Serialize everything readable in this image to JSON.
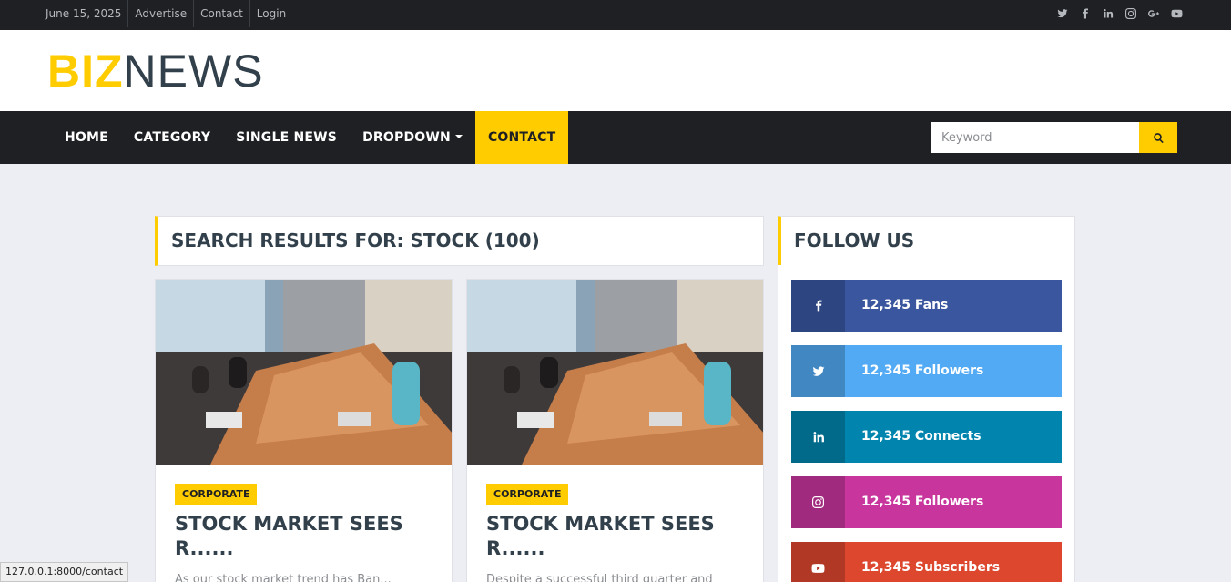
{
  "topbar": {
    "links": [
      "June 15, 2025",
      "Advertise",
      "Contact",
      "Login"
    ],
    "social_icons": [
      "twitter-icon",
      "facebook-icon",
      "linkedin-icon",
      "instagram-icon",
      "google-plus-icon",
      "youtube-icon"
    ]
  },
  "logo": {
    "part1": "BIZ",
    "part2": "NEWS"
  },
  "nav": {
    "items": [
      "HOME",
      "CATEGORY",
      "SINGLE NEWS",
      "DROPDOWN",
      "CONTACT"
    ],
    "active": "CONTACT",
    "search_placeholder": "Keyword"
  },
  "results": {
    "heading": "SEARCH RESULTS FOR: STOCK (100)",
    "cards": [
      {
        "category": "CORPORATE",
        "title": "STOCK MARKET SEES R......",
        "excerpt": "As our stock market trend has Ban..."
      },
      {
        "category": "CORPORATE",
        "title": "STOCK MARKET SEES R......",
        "excerpt": "Despite a successful third quarter and"
      }
    ]
  },
  "sidebar": {
    "heading": "FOLLOW US",
    "social": [
      {
        "icon": "facebook-icon",
        "text": "12,345 Fans",
        "color": "#39569e",
        "dark": "#2d4580"
      },
      {
        "icon": "twitter-icon",
        "text": "12,345 Followers",
        "color": "#52aaf4",
        "dark": "#4188c3"
      },
      {
        "icon": "linkedin-icon",
        "text": "12,345 Connects",
        "color": "#0185ae",
        "dark": "#016a8b"
      },
      {
        "icon": "instagram-icon",
        "text": "12,345 Followers",
        "color": "#c8359d",
        "dark": "#a02a7d"
      },
      {
        "icon": "youtube-icon",
        "text": "12,345 Subscribers",
        "color": "#dc472e",
        "dark": "#b03824"
      }
    ]
  },
  "status_url": "127.0.0.1:8000/contact",
  "colors": {
    "accent": "#ffcc00",
    "dark": "#1e2024",
    "heading": "#31404b",
    "page_bg": "#edeef3"
  }
}
